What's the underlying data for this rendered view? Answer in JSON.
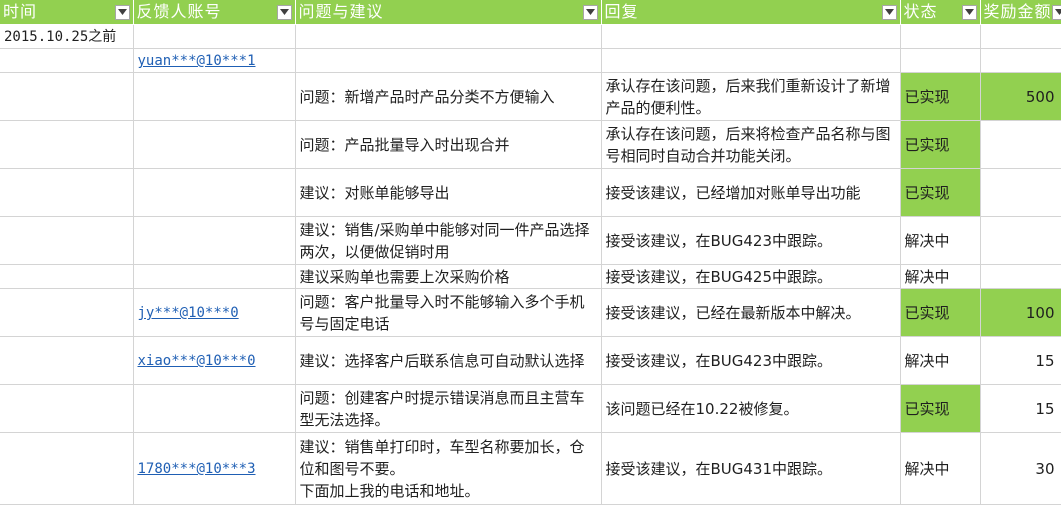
{
  "headers": [
    "时间",
    "反馈人账号",
    "问题与建议",
    "回复",
    "状态",
    "奖励金额"
  ],
  "icons": {
    "filter": "filter-dropdown-icon"
  },
  "colors": {
    "header_bg": "#92d050",
    "done_bg": "#92d050",
    "link": "#1f5fb4"
  },
  "rows": [
    {
      "time": "2015.10.25之前",
      "account": "",
      "issue": "",
      "reply": "",
      "status": "",
      "amount": "",
      "done": false
    },
    {
      "time": "",
      "account": "yuan***@10***1",
      "issue": "",
      "reply": "",
      "status": "",
      "amount": "",
      "done": false
    },
    {
      "time": "",
      "account": "",
      "issue": "问题：新增产品时产品分类不方便输入",
      "reply": "承认存在该问题，后来我们重新设计了新增产品的便利性。",
      "status": "已实现",
      "amount": "500",
      "done": true,
      "amount_green": true
    },
    {
      "time": "",
      "account": "",
      "issue": "问题：产品批量导入时出现合并",
      "reply": "承认存在该问题，后来将检查产品名称与图号相同时自动合并功能关闭。",
      "status": "已实现",
      "amount": "",
      "done": true
    },
    {
      "time": "",
      "account": "",
      "issue": "建议：对账单能够导出",
      "reply": "接受该建议，已经增加对账单导出功能",
      "status": "已实现",
      "amount": "",
      "done": true
    },
    {
      "time": "",
      "account": "",
      "issue": "建议：销售/采购单中能够对同一件产品选择两次，以便做促销时用",
      "reply": "接受该建议，在BUG423中跟踪。",
      "status": "解决中",
      "amount": "",
      "done": false
    },
    {
      "time": "",
      "account": "",
      "issue": "建议采购单也需要上次采购价格",
      "reply": "接受该建议，在BUG425中跟踪。",
      "status": "解决中",
      "amount": "",
      "done": false
    },
    {
      "time": "",
      "account": "jy***@10***0",
      "issue": "问题：客户批量导入时不能够输入多个手机号与固定电话",
      "reply": "接受该建议，已经在最新版本中解决。",
      "status": "已实现",
      "amount": "100",
      "done": true,
      "amount_green": true
    },
    {
      "time": "",
      "account": "xiao***@10***0",
      "issue": "建议：选择客户后联系信息可自动默认选择",
      "reply": "接受该建议，在BUG423中跟踪。",
      "status": "解决中",
      "amount": "15",
      "done": false
    },
    {
      "time": "",
      "account": "",
      "issue": "问题：创建客户时提示错误消息而且主营车型无法选择。",
      "reply": "该问题已经在10.22被修复。",
      "status": "已实现",
      "amount": "15",
      "done": true
    },
    {
      "time": "",
      "account": "1780***@10***3",
      "issue": "建议：销售单打印时，车型名称要加长，仓位和图号不要。\n下面加上我的电话和地址。",
      "reply": "接受该建议，在BUG431中跟踪。",
      "status": "解决中",
      "amount": "30",
      "done": false
    }
  ]
}
